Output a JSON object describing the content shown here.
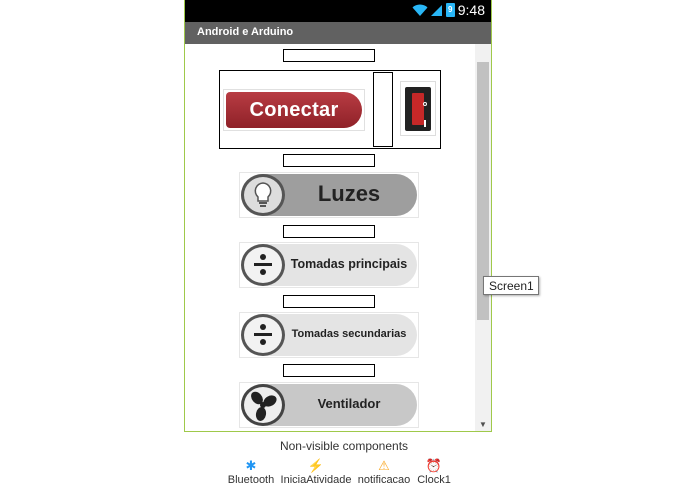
{
  "status_bar": {
    "time": "9:48",
    "wifi_icon": "wifi-icon",
    "signal_icon": "signal-icon",
    "battery_icon": "battery-icon",
    "battery_level": "9"
  },
  "app": {
    "title": "Android e Arduino"
  },
  "connect": {
    "label": "Conectar"
  },
  "buttons": {
    "luzes": "Luzes",
    "tomadas_principais": "Tomadas principais",
    "tomadas_secundarias": "Tomadas secundarias",
    "ventilador": "Ventilador"
  },
  "tooltip": {
    "text": "Screen1"
  },
  "non_visible": {
    "title": "Non-visible components",
    "items": [
      {
        "label": "Bluetooth",
        "icon": "bluetooth-icon"
      },
      {
        "label": "IniciaAtividade",
        "icon": "lightning-icon"
      },
      {
        "label": "notificacao",
        "icon": "warning-icon"
      },
      {
        "label": "Clock1",
        "icon": "alarm-clock-icon"
      }
    ]
  },
  "colors": {
    "connect_red": "#a82f36",
    "frame_green": "#9fc94a",
    "titlebar": "#616161",
    "button_gray": "#9e9e9e"
  }
}
